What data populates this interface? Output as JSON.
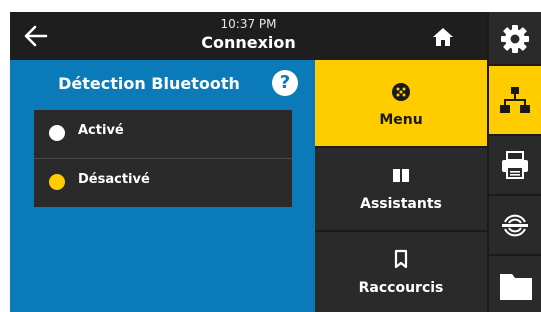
{
  "header": {
    "time": "10:37 PM",
    "title": "Connexion"
  },
  "panel": {
    "title": "Détection Bluetooth",
    "help_symbol": "?",
    "options": [
      {
        "label": "Activé",
        "selected": false,
        "radio_color": "#ffffff"
      },
      {
        "label": "Désactivé",
        "selected": true,
        "radio_color": "#ffcc00"
      }
    ]
  },
  "menu_tiles": [
    {
      "label": "Menu",
      "icon": "grid-dots-icon",
      "active": true
    },
    {
      "label": "Assistants",
      "icon": "book-icon",
      "active": false
    },
    {
      "label": "Raccourcis",
      "icon": "bookmark-icon",
      "active": false
    }
  ],
  "side_icons": [
    "gear-icon",
    "network-icon",
    "printer-icon",
    "rfid-icon",
    "folder-icon"
  ],
  "colors": {
    "accent": "#ffcc00",
    "panel_blue": "#0b7ab9",
    "dark": "#1a1a1a",
    "tile": "#2a2a2a"
  }
}
